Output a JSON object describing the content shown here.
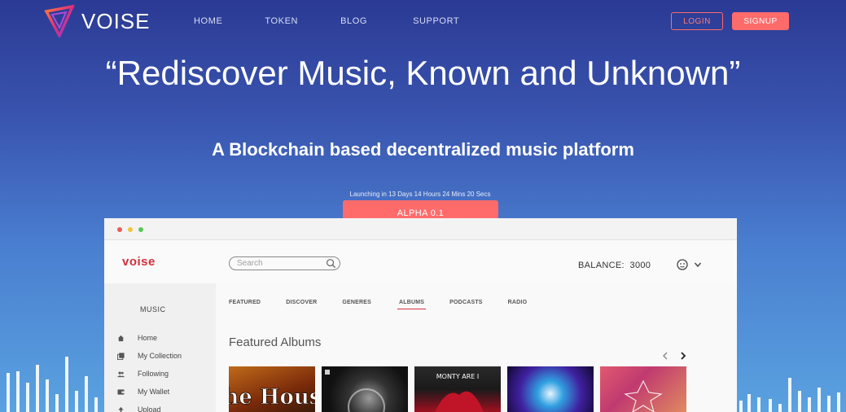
{
  "site": {
    "brand": "VOISE",
    "nav": [
      "HOME",
      "TOKEN",
      "BLOG",
      "SUPPORT"
    ],
    "login_label": "LOGIN",
    "signup_label": "SIGNUP",
    "headline": "“Rediscover Music, Known and Unknown”",
    "subheadline": "A Blockchain based decentralized music platform",
    "launch_text": "Launching in 13 Days 14 Hours 24 Mins 20 Secs",
    "alpha_label": "ALPHA 0.1",
    "accent": "#ff6b6b"
  },
  "app": {
    "brand": "voise",
    "search_placeholder": "Search",
    "balance_label": "BALANCE:",
    "balance_value": "3000",
    "sidebar_title": "MUSIC",
    "sidebar_items": [
      "Home",
      "My Collection",
      "Following",
      "My Wallet",
      "Upload"
    ],
    "tabs": [
      "FEATURED",
      "DISCOVER",
      "GENERES",
      "ALBUMS",
      "PODCASTS",
      "RADIO"
    ],
    "active_tab": "ALBUMS",
    "section_title": "Featured Albums",
    "album_titles": [
      "The House",
      "",
      "MONTY ARE I",
      "",
      ""
    ]
  }
}
